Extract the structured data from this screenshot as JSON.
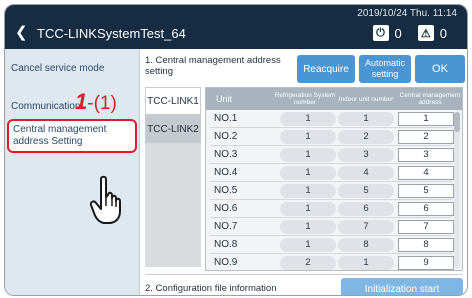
{
  "header": {
    "datetime": "2019/10/24 Thu. 11:14",
    "back_icon": "chevron-left-icon",
    "title": "TCC-LINKSystemTest_64",
    "status": [
      {
        "icon": "power-icon",
        "glyph": "⏻",
        "count": "0"
      },
      {
        "icon": "warning-icon",
        "glyph": "⚠",
        "count": "0"
      }
    ]
  },
  "sidebar": {
    "items": [
      {
        "label": "Cancel service mode"
      },
      {
        "label": "Communication"
      },
      {
        "label": "Central management address Setting"
      }
    ],
    "annotation": {
      "number": "1",
      "sub": "-(1)"
    },
    "pointer_icon": "hand-pointer-icon"
  },
  "main": {
    "section1_title": "1. Central management address setting",
    "buttons": {
      "reacquire": "Reacquire",
      "automatic": "Automatic setting",
      "ok": "OK"
    },
    "tabs": [
      {
        "label": "TCC-LINK1"
      },
      {
        "label": "TCC-LINK2"
      }
    ],
    "table": {
      "headers": {
        "unit": "Unit",
        "refrigeration": "Refrigeration System number",
        "indoor": "Indoor unit number",
        "central": "Central management address"
      },
      "rows": [
        {
          "unit": "NO.1",
          "ref": "1",
          "ind": "1",
          "cen": "1"
        },
        {
          "unit": "NO.2",
          "ref": "1",
          "ind": "2",
          "cen": "2"
        },
        {
          "unit": "NO.3",
          "ref": "1",
          "ind": "3",
          "cen": "3"
        },
        {
          "unit": "NO.4",
          "ref": "1",
          "ind": "4",
          "cen": "4"
        },
        {
          "unit": "NO.5",
          "ref": "1",
          "ind": "5",
          "cen": "5"
        },
        {
          "unit": "NO.6",
          "ref": "1",
          "ind": "6",
          "cen": "6"
        },
        {
          "unit": "NO.7",
          "ref": "1",
          "ind": "7",
          "cen": "7"
        },
        {
          "unit": "NO.8",
          "ref": "1",
          "ind": "8",
          "cen": "8"
        },
        {
          "unit": "NO.9",
          "ref": "2",
          "ind": "1",
          "cen": "9"
        }
      ]
    },
    "section2_title": "2. Configuration file information",
    "init_button": "Initialization start"
  },
  "colors": {
    "header_bg": "#152c42",
    "sidebar_bg": "#dfe8ef",
    "accent_button": "#4a95d3",
    "highlight_red": "#d81f2a"
  }
}
